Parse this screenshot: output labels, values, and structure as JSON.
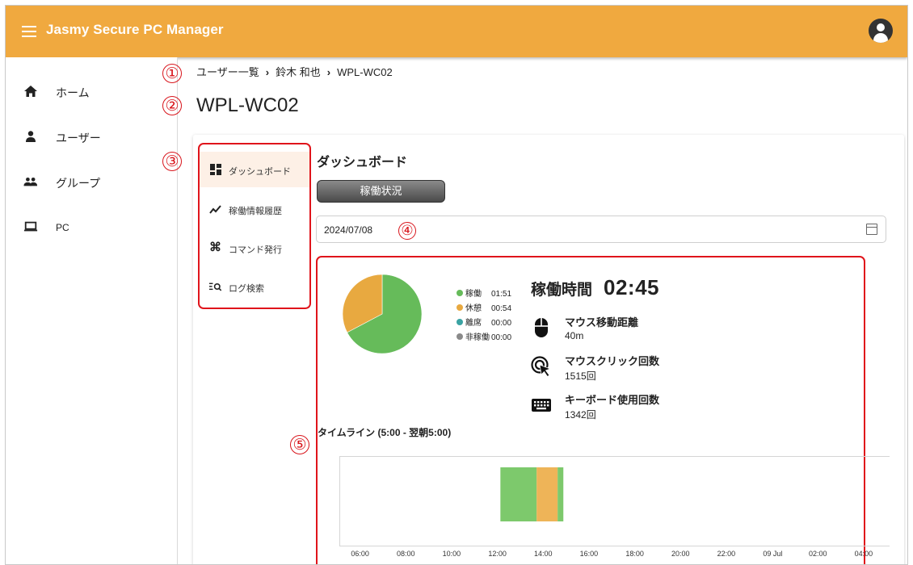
{
  "app": {
    "title": "Jasmy Secure PC Manager"
  },
  "sidebar": {
    "items": [
      {
        "label": "ホーム",
        "icon": "home-icon"
      },
      {
        "label": "ユーザー",
        "icon": "user-icon"
      },
      {
        "label": "グループ",
        "icon": "group-icon"
      },
      {
        "label": "PC",
        "icon": "pc-icon"
      }
    ]
  },
  "annotations": [
    "①",
    "②",
    "③",
    "④",
    "⑤"
  ],
  "breadcrumb": [
    "ユーザー一覧",
    "鈴木 和也",
    "WPL-WC02"
  ],
  "page_title": "WPL-WC02",
  "subnav": {
    "items": [
      {
        "label": "ダッシュボード",
        "icon": "dashboard-icon"
      },
      {
        "label": "稼働情報履歴",
        "icon": "trend-icon"
      },
      {
        "label": "コマンド発行",
        "icon": "command-icon"
      },
      {
        "label": "ログ検索",
        "icon": "log-search-icon"
      }
    ]
  },
  "content": {
    "title": "ダッシュボード",
    "status_button": "稼働状況",
    "date": "2024/07/08"
  },
  "summary": {
    "operating_label": "稼働時間",
    "operating_value": "02:45",
    "legend": [
      {
        "label": "稼働",
        "time": "01:51",
        "color": "#66bb5a"
      },
      {
        "label": "休憩",
        "time": "00:54",
        "color": "#e8a940"
      },
      {
        "label": "離席",
        "time": "00:00",
        "color": "#3aa3a3"
      },
      {
        "label": "非稼働",
        "time": "00:00",
        "color": "#8a8a8a"
      }
    ],
    "metrics": [
      {
        "label": "マウス移動距離",
        "value": "40m",
        "icon": "mouse-icon"
      },
      {
        "label": "マウスクリック回数",
        "value": "1515回",
        "icon": "click-icon"
      },
      {
        "label": "キーボード使用回数",
        "value": "1342回",
        "icon": "keyboard-icon"
      }
    ]
  },
  "chart_data": [
    {
      "type": "pie",
      "labels": [
        "稼働",
        "休憩",
        "離席",
        "非稼働"
      ],
      "values": [
        111,
        54,
        0,
        0
      ],
      "colors": [
        "#66bb5a",
        "#e8a940",
        "#3aa3a3",
        "#8a8a8a"
      ]
    },
    {
      "type": "timeline",
      "title": "タイムライン (5:00 - 翌朝5:00)",
      "tick_labels": [
        "06:00",
        "08:00",
        "10:00",
        "12:00",
        "14:00",
        "16:00",
        "18:00",
        "20:00",
        "22:00",
        "09 Jul",
        "02:00",
        "04:00"
      ],
      "tick_hours": [
        6,
        8,
        10,
        12,
        14,
        16,
        18,
        20,
        22,
        24,
        26,
        28
      ],
      "x_range_hours": [
        5,
        29
      ],
      "segments": [
        {
          "start": "12:00",
          "end": "13:35",
          "state": "稼働",
          "color": "#7dc96c"
        },
        {
          "start": "13:35",
          "end": "14:30",
          "state": "休憩",
          "color": "#eeb458"
        },
        {
          "start": "14:30",
          "end": "14:45",
          "state": "稼働",
          "color": "#7dc96c"
        }
      ]
    }
  ]
}
